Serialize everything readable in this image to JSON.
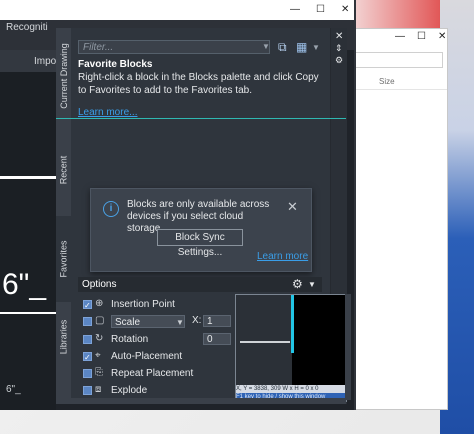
{
  "acad_window": {
    "title_fragment": "Recogniti",
    "ribbon_fragment": "Impo",
    "drawing_text": "6\"_",
    "drawing_text2": "6\"_"
  },
  "explorer": {
    "column_size": "Size",
    "buttons": [
      "—",
      "☐",
      "✕"
    ]
  },
  "palette": {
    "filter_placeholder": "Filter...",
    "tabs": [
      "Current Drawing",
      "Recent",
      "Favorites",
      "Libraries"
    ],
    "active_tab": "Favorites",
    "favorites_title": "Favorite Blocks",
    "favorites_description": "Right-click a block in the Blocks palette and click Copy to Favorites to add to the Favorites tab.",
    "learn_more": "Learn more...",
    "toast": {
      "message": "Blocks are only available across devices if you select cloud storage.",
      "button": "Block Sync Settings...",
      "learn_more": "Learn more"
    },
    "options": {
      "header": "Options",
      "rows": [
        {
          "label": "Insertion Point",
          "checked": true,
          "icon": "insertion-point-icon"
        },
        {
          "label": "Scale",
          "checked": false,
          "icon": "scale-icon"
        },
        {
          "label": "Rotation",
          "checked": false,
          "icon": "rotation-icon"
        },
        {
          "label": "Auto-Placement",
          "checked": true,
          "icon": "auto-placement-icon"
        },
        {
          "label": "Repeat Placement",
          "checked": false,
          "icon": "repeat-placement-icon"
        },
        {
          "label": "Explode",
          "checked": false,
          "icon": "explode-icon"
        }
      ],
      "scale_value": "Scale",
      "x_label": "X:",
      "x_value": "1",
      "rotation_value": "0"
    },
    "preview": {
      "coords": "X, Y = 3838, 309     W x H = 0 x 0",
      "hint": "F1 key to hide / show this window"
    }
  },
  "colors": {
    "accent_blue": "#3a9ee8",
    "teal": "#2fb8b1",
    "cyan_preview": "#22c6e6"
  }
}
